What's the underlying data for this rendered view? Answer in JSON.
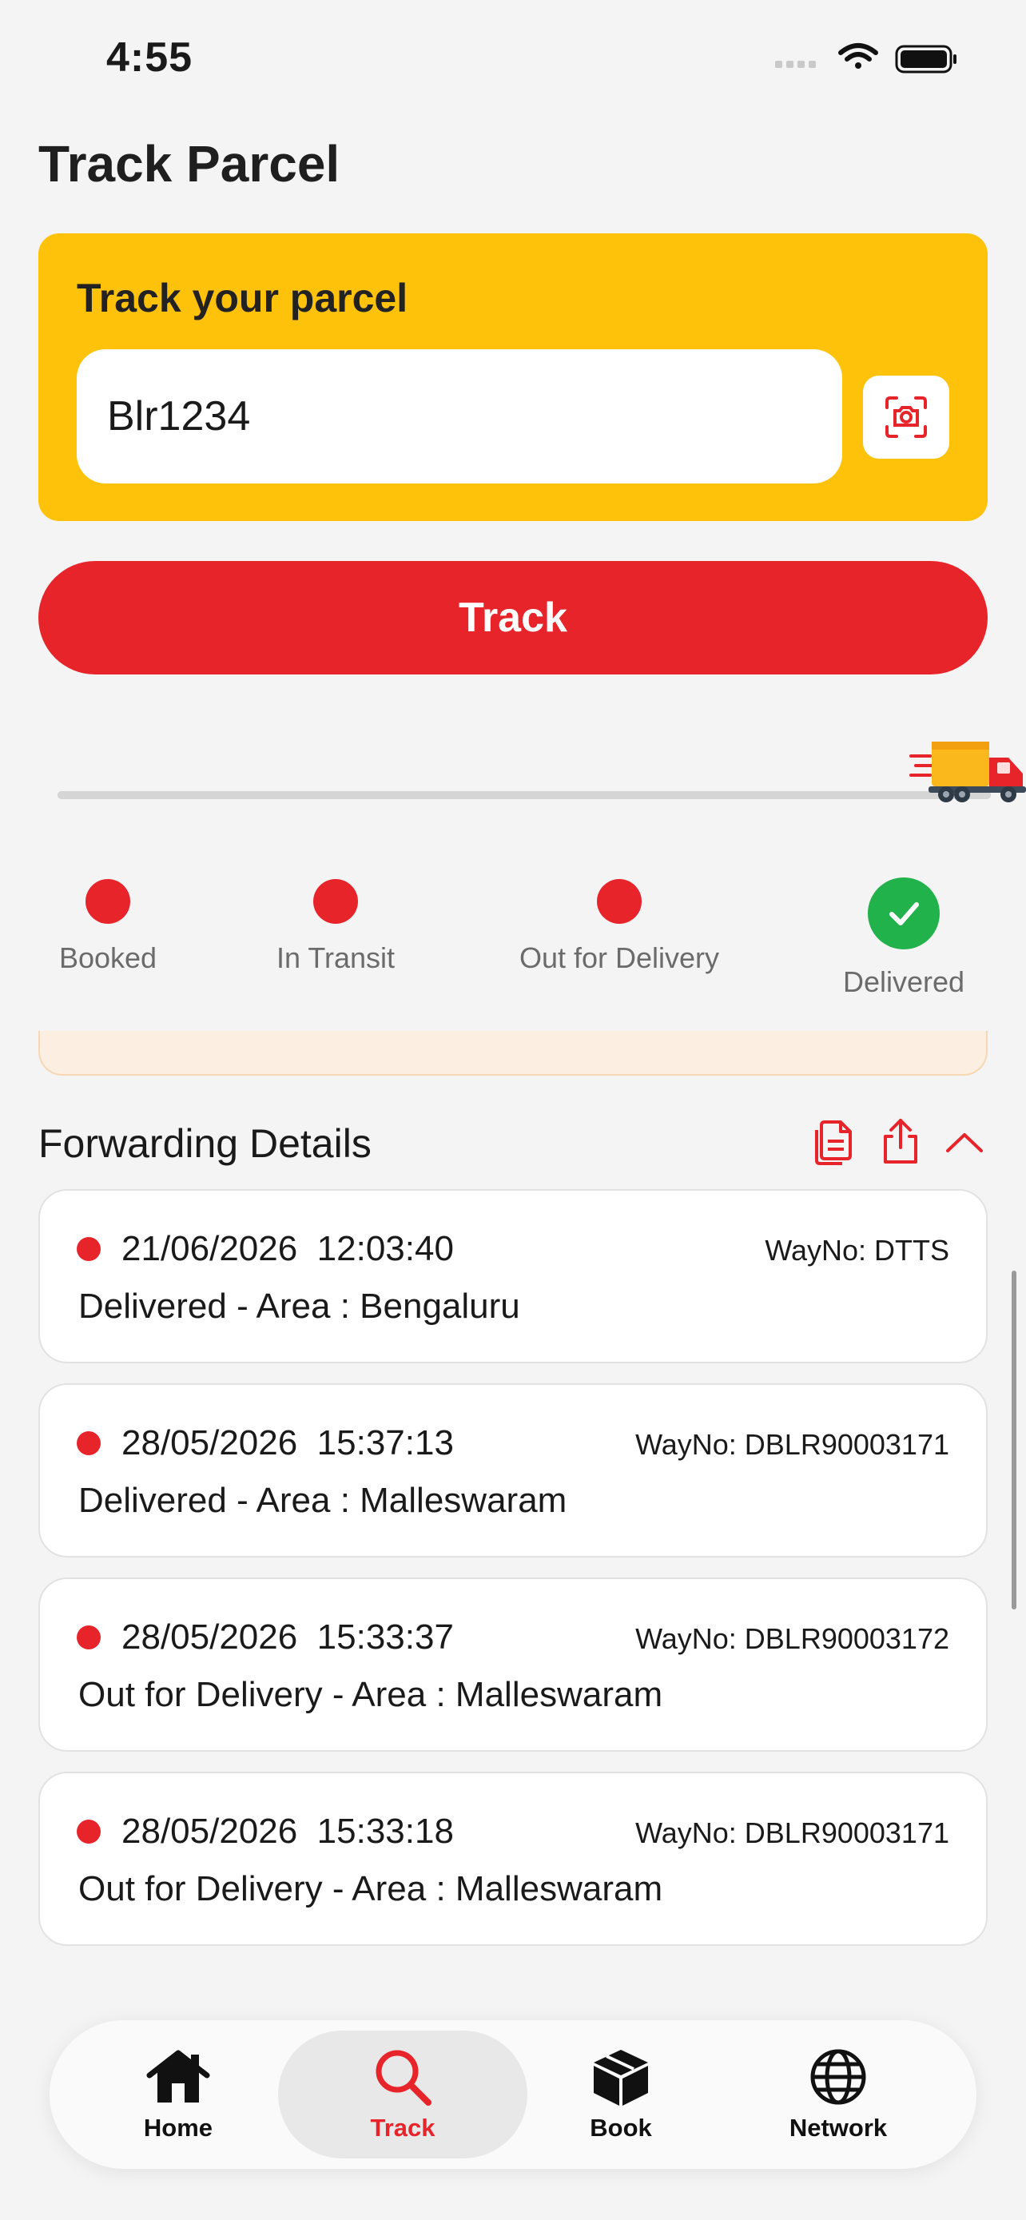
{
  "status_bar": {
    "time": "4:55"
  },
  "page": {
    "title": "Track Parcel"
  },
  "track_card": {
    "title": "Track your parcel",
    "input_value": "Blr1234",
    "input_placeholder": ""
  },
  "track_button": {
    "label": "Track"
  },
  "progress": {
    "fraction": 1.0
  },
  "stages": [
    {
      "label": "Booked",
      "state": "reached"
    },
    {
      "label": "In Transit",
      "state": "reached"
    },
    {
      "label": "Out for Delivery",
      "state": "reached"
    },
    {
      "label": "Delivered",
      "state": "completed"
    }
  ],
  "forwarding": {
    "title": "Forwarding Details",
    "entries": [
      {
        "datetime": "21/06/2026  12:03:40",
        "wayno": "WayNo: DTTS",
        "status": "Delivered - Area : Bengaluru"
      },
      {
        "datetime": "28/05/2026  15:37:13",
        "wayno": "WayNo: DBLR90003171",
        "status": "Delivered - Area : Malleswaram"
      },
      {
        "datetime": "28/05/2026  15:33:37",
        "wayno": "WayNo: DBLR90003172",
        "status": "Out for Delivery - Area : Malleswaram"
      },
      {
        "datetime": "28/05/2026  15:33:18",
        "wayno": "WayNo: DBLR90003171",
        "status": "Out for Delivery - Area : Malleswaram"
      }
    ]
  },
  "bottom_nav": {
    "items": [
      {
        "label": "Home",
        "icon": "home-icon"
      },
      {
        "label": "Track",
        "icon": "search-icon",
        "active": true
      },
      {
        "label": "Book",
        "icon": "box-icon"
      },
      {
        "label": "Network",
        "icon": "globe-icon"
      }
    ]
  },
  "colors": {
    "brand_red": "#e8242b",
    "brand_yellow": "#fec20b",
    "success_green": "#21b24b"
  }
}
